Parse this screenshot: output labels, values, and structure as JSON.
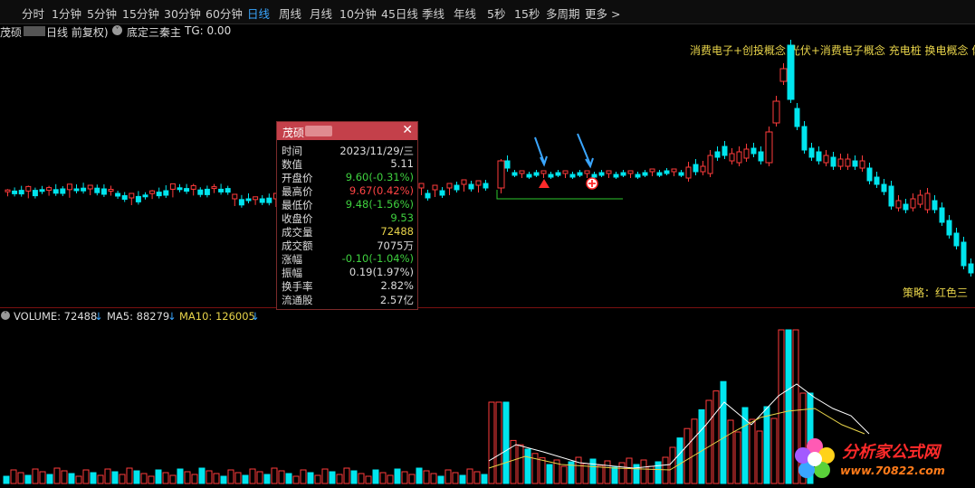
{
  "toolbar": {
    "items": [
      "分时",
      "1分钟",
      "5分钟",
      "15分钟",
      "30分钟",
      "60分钟",
      "日线",
      "周线",
      "月线",
      "10分钟",
      "45日线",
      "季线",
      "年线",
      "5秒",
      "15秒",
      "多周期",
      "更多 >"
    ],
    "active": "日线"
  },
  "title_row": {
    "name_prefix": "茂硕",
    "period": "日线 前复权)",
    "indicator": "底定三秦主",
    "tg_label": "TG: 0.00"
  },
  "concepts_text": "消费电子+创投概念 光伏+消费电子概念 充电桩 换电概念 体",
  "strategy_text": "策略：红色三",
  "volume_legend": {
    "volume": "VOLUME: 72488",
    "ma5": "MA5: 88279",
    "ma10": "MA10: 126005"
  },
  "infobox": {
    "title": "茂硕",
    "rows": [
      {
        "label": "时间",
        "value": "2023/11/29/三",
        "color": "#dddddd"
      },
      {
        "label": "数值",
        "value": "5.11",
        "color": "#dddddd"
      },
      {
        "label": "开盘价",
        "value": "9.60(-0.31%)",
        "color": "#3fd23f"
      },
      {
        "label": "最高价",
        "value": "9.67(0.42%)",
        "color": "#ff4444"
      },
      {
        "label": "最低价",
        "value": "9.48(-1.56%)",
        "color": "#3fd23f"
      },
      {
        "label": "收盘价",
        "value": "9.53",
        "color": "#3fd23f"
      },
      {
        "label": "成交量",
        "value": "72488",
        "color": "#e8d44a"
      },
      {
        "label": "成交额",
        "value": "7075万",
        "color": "#dddddd"
      },
      {
        "label": "涨幅",
        "value": "-0.10(-1.04%)",
        "color": "#3fd23f"
      },
      {
        "label": "振幅",
        "value": "0.19(1.97%)",
        "color": "#dddddd"
      },
      {
        "label": "换手率",
        "value": "2.82%",
        "color": "#dddddd"
      },
      {
        "label": "流通股",
        "value": "2.57亿",
        "color": "#dddddd"
      }
    ]
  },
  "logo": {
    "title": "分析家公式网",
    "url": "www.70822.com"
  },
  "colors": {
    "up": "#ff3b3b",
    "down": "#00e5ee",
    "ma5": "#ffffff",
    "ma10": "#e8d44a",
    "accent": "#3aa6ff"
  },
  "icons": [
    "chevron-right-icon",
    "close-icon",
    "collapse-icon",
    "arrow-down-icon",
    "buy-signal-icon",
    "plus-signal-icon"
  ]
}
